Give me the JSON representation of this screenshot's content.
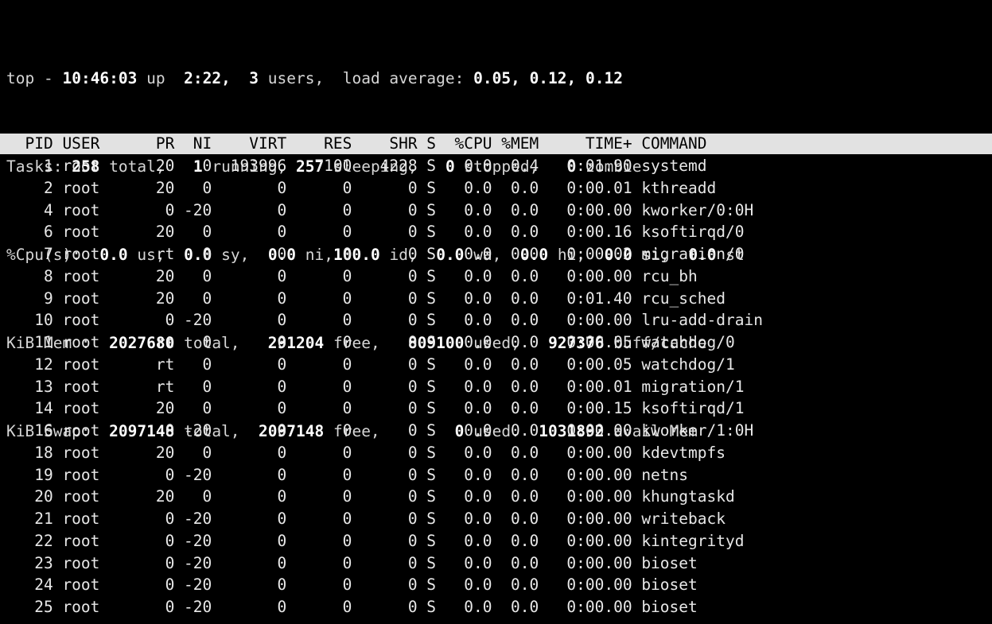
{
  "terminal": {
    "background": "#000000",
    "foreground": "#d8d8d8",
    "bold_foreground": "#ffffff",
    "header_bar_background": "#e2e2e2",
    "header_bar_foreground": "#000000",
    "columns": 86,
    "rows": 28
  },
  "summary": {
    "uptime_line": {
      "program": "top",
      "separator": "-",
      "time": "10:46:03",
      "up_label": "up",
      "uptime": "2:22,",
      "users_count": "3",
      "users_label": "users,",
      "load_label": "load average:",
      "load_1min": "0.05,",
      "load_5min": "0.12,",
      "load_15min": "0.12",
      "text": "top - 10:46:03 up  2:22,  3 users,  load average: 0.05, 0.12, 0.12"
    },
    "tasks_line": {
      "label": "Tasks:",
      "total": "258",
      "total_label": "total,",
      "running": "1",
      "running_label": "running,",
      "sleeping": "257",
      "sleeping_label": "sleeping,",
      "stopped": "0",
      "stopped_label": "stopped,",
      "zombie": "0",
      "zombie_label": "zombie",
      "text": "Tasks: 258 total,   1 running, 257 sleeping,   0 stopped,   0 zombie"
    },
    "cpu_line": {
      "label": "%Cpu(s):",
      "us": "0.0",
      "us_label": "us,",
      "sy": "0.0",
      "sy_label": "sy,",
      "ni": "0.0",
      "ni_label": "ni,",
      "id": "100.0",
      "id_label": "id,",
      "wa": "0.0",
      "wa_label": "wa,",
      "hi": "0.0",
      "hi_label": "hi,",
      "si": "0.0",
      "si_label": "si,",
      "st": "0.0",
      "st_label": "st",
      "text": "%Cpu(s):  0.0 us,  0.0 sy,  0.0 ni,100.0 id,  0.0 wa,  0.0 hi,  0.0 si,  0.0 st"
    },
    "mem_line": {
      "label": "KiB Mem :",
      "total": "2027680",
      "total_label": "total,",
      "free": "291204",
      "free_label": "free,",
      "used": "809100",
      "used_label": "used,",
      "buffcache": "927376",
      "buffcache_label": "buff/cache",
      "text": "KiB Mem :  2027680 total,   291204 free,   809100 used,   927376 buff/cache"
    },
    "swap_line": {
      "label": "KiB Swap:",
      "total": "2097148",
      "total_label": "total,",
      "free": "2097148",
      "free_label": "free,",
      "used": "0",
      "used_label": "used.",
      "avail": "1031892",
      "avail_label": "avail Mem",
      "text": "KiB Swap:  2097148 total,  2097148 free,        0 used.  1031892 avail Mem"
    }
  },
  "table": {
    "header_text": "  PID USER      PR  NI    VIRT    RES    SHR S  %CPU %MEM     TIME+ COMMAND ",
    "columns": [
      "PID",
      "USER",
      "PR",
      "NI",
      "VIRT",
      "RES",
      "SHR",
      "S",
      "%CPU",
      "%MEM",
      "TIME+",
      "COMMAND"
    ],
    "rows": [
      {
        "pid": "1",
        "user": "root",
        "pr": "20",
        "ni": "0",
        "virt": "193996",
        "res": "7100",
        "shr": "4228",
        "s": "S",
        "cpu": "0.0",
        "mem": "0.4",
        "time": "0:01.90",
        "command": "systemd",
        "text": "    1 root      20   0  193996   7100   4228 S   0.0  0.4   0:01.90 systemd"
      },
      {
        "pid": "2",
        "user": "root",
        "pr": "20",
        "ni": "0",
        "virt": "0",
        "res": "0",
        "shr": "0",
        "s": "S",
        "cpu": "0.0",
        "mem": "0.0",
        "time": "0:00.01",
        "command": "kthreadd",
        "text": "    2 root      20   0       0      0      0 S   0.0  0.0   0:00.01 kthreadd"
      },
      {
        "pid": "4",
        "user": "root",
        "pr": "0",
        "ni": "-20",
        "virt": "0",
        "res": "0",
        "shr": "0",
        "s": "S",
        "cpu": "0.0",
        "mem": "0.0",
        "time": "0:00.00",
        "command": "kworker/0:0H",
        "text": "    4 root       0 -20       0      0      0 S   0.0  0.0   0:00.00 kworker/0:0H"
      },
      {
        "pid": "6",
        "user": "root",
        "pr": "20",
        "ni": "0",
        "virt": "0",
        "res": "0",
        "shr": "0",
        "s": "S",
        "cpu": "0.0",
        "mem": "0.0",
        "time": "0:00.16",
        "command": "ksoftirqd/0",
        "text": "    6 root      20   0       0      0      0 S   0.0  0.0   0:00.16 ksoftirqd/0"
      },
      {
        "pid": "7",
        "user": "root",
        "pr": "rt",
        "ni": "0",
        "virt": "0",
        "res": "0",
        "shr": "0",
        "s": "S",
        "cpu": "0.0",
        "mem": "0.0",
        "time": "0:00.02",
        "command": "migration/0",
        "text": "    7 root      rt   0       0      0      0 S   0.0  0.0   0:00.02 migration/0"
      },
      {
        "pid": "8",
        "user": "root",
        "pr": "20",
        "ni": "0",
        "virt": "0",
        "res": "0",
        "shr": "0",
        "s": "S",
        "cpu": "0.0",
        "mem": "0.0",
        "time": "0:00.00",
        "command": "rcu_bh",
        "text": "    8 root      20   0       0      0      0 S   0.0  0.0   0:00.00 rcu_bh"
      },
      {
        "pid": "9",
        "user": "root",
        "pr": "20",
        "ni": "0",
        "virt": "0",
        "res": "0",
        "shr": "0",
        "s": "S",
        "cpu": "0.0",
        "mem": "0.0",
        "time": "0:01.40",
        "command": "rcu_sched",
        "text": "    9 root      20   0       0      0      0 S   0.0  0.0   0:01.40 rcu_sched"
      },
      {
        "pid": "10",
        "user": "root",
        "pr": "0",
        "ni": "-20",
        "virt": "0",
        "res": "0",
        "shr": "0",
        "s": "S",
        "cpu": "0.0",
        "mem": "0.0",
        "time": "0:00.00",
        "command": "lru-add-drain",
        "text": "   10 root       0 -20       0      0      0 S   0.0  0.0   0:00.00 lru-add-drain"
      },
      {
        "pid": "11",
        "user": "root",
        "pr": "rt",
        "ni": "0",
        "virt": "0",
        "res": "0",
        "shr": "0",
        "s": "S",
        "cpu": "0.0",
        "mem": "0.0",
        "time": "0:00.05",
        "command": "watchdog/0",
        "text": "   11 root      rt   0       0      0      0 S   0.0  0.0   0:00.05 watchdog/0"
      },
      {
        "pid": "12",
        "user": "root",
        "pr": "rt",
        "ni": "0",
        "virt": "0",
        "res": "0",
        "shr": "0",
        "s": "S",
        "cpu": "0.0",
        "mem": "0.0",
        "time": "0:00.05",
        "command": "watchdog/1",
        "text": "   12 root      rt   0       0      0      0 S   0.0  0.0   0:00.05 watchdog/1"
      },
      {
        "pid": "13",
        "user": "root",
        "pr": "rt",
        "ni": "0",
        "virt": "0",
        "res": "0",
        "shr": "0",
        "s": "S",
        "cpu": "0.0",
        "mem": "0.0",
        "time": "0:00.01",
        "command": "migration/1",
        "text": "   13 root      rt   0       0      0      0 S   0.0  0.0   0:00.01 migration/1"
      },
      {
        "pid": "14",
        "user": "root",
        "pr": "20",
        "ni": "0",
        "virt": "0",
        "res": "0",
        "shr": "0",
        "s": "S",
        "cpu": "0.0",
        "mem": "0.0",
        "time": "0:00.15",
        "command": "ksoftirqd/1",
        "text": "   14 root      20   0       0      0      0 S   0.0  0.0   0:00.15 ksoftirqd/1"
      },
      {
        "pid": "16",
        "user": "root",
        "pr": "0",
        "ni": "-20",
        "virt": "0",
        "res": "0",
        "shr": "0",
        "s": "S",
        "cpu": "0.0",
        "mem": "0.0",
        "time": "0:00.00",
        "command": "kworker/1:0H",
        "text": "   16 root       0 -20       0      0      0 S   0.0  0.0   0:00.00 kworker/1:0H"
      },
      {
        "pid": "18",
        "user": "root",
        "pr": "20",
        "ni": "0",
        "virt": "0",
        "res": "0",
        "shr": "0",
        "s": "S",
        "cpu": "0.0",
        "mem": "0.0",
        "time": "0:00.00",
        "command": "kdevtmpfs",
        "text": "   18 root      20   0       0      0      0 S   0.0  0.0   0:00.00 kdevtmpfs"
      },
      {
        "pid": "19",
        "user": "root",
        "pr": "0",
        "ni": "-20",
        "virt": "0",
        "res": "0",
        "shr": "0",
        "s": "S",
        "cpu": "0.0",
        "mem": "0.0",
        "time": "0:00.00",
        "command": "netns",
        "text": "   19 root       0 -20       0      0      0 S   0.0  0.0   0:00.00 netns"
      },
      {
        "pid": "20",
        "user": "root",
        "pr": "20",
        "ni": "0",
        "virt": "0",
        "res": "0",
        "shr": "0",
        "s": "S",
        "cpu": "0.0",
        "mem": "0.0",
        "time": "0:00.00",
        "command": "khungtaskd",
        "text": "   20 root      20   0       0      0      0 S   0.0  0.0   0:00.00 khungtaskd"
      },
      {
        "pid": "21",
        "user": "root",
        "pr": "0",
        "ni": "-20",
        "virt": "0",
        "res": "0",
        "shr": "0",
        "s": "S",
        "cpu": "0.0",
        "mem": "0.0",
        "time": "0:00.00",
        "command": "writeback",
        "text": "   21 root       0 -20       0      0      0 S   0.0  0.0   0:00.00 writeback"
      },
      {
        "pid": "22",
        "user": "root",
        "pr": "0",
        "ni": "-20",
        "virt": "0",
        "res": "0",
        "shr": "0",
        "s": "S",
        "cpu": "0.0",
        "mem": "0.0",
        "time": "0:00.00",
        "command": "kintegrityd",
        "text": "   22 root       0 -20       0      0      0 S   0.0  0.0   0:00.00 kintegrityd"
      },
      {
        "pid": "23",
        "user": "root",
        "pr": "0",
        "ni": "-20",
        "virt": "0",
        "res": "0",
        "shr": "0",
        "s": "S",
        "cpu": "0.0",
        "mem": "0.0",
        "time": "0:00.00",
        "command": "bioset",
        "text": "   23 root       0 -20       0      0      0 S   0.0  0.0   0:00.00 bioset"
      },
      {
        "pid": "24",
        "user": "root",
        "pr": "0",
        "ni": "-20",
        "virt": "0",
        "res": "0",
        "shr": "0",
        "s": "S",
        "cpu": "0.0",
        "mem": "0.0",
        "time": "0:00.00",
        "command": "bioset",
        "text": "   24 root       0 -20       0      0      0 S   0.0  0.0   0:00.00 bioset"
      },
      {
        "pid": "25",
        "user": "root",
        "pr": "0",
        "ni": "-20",
        "virt": "0",
        "res": "0",
        "shr": "0",
        "s": "S",
        "cpu": "0.0",
        "mem": "0.0",
        "time": "0:00.00",
        "command": "bioset",
        "text": "   25 root       0 -20       0      0      0 S   0.0  0.0   0:00.00 bioset"
      }
    ]
  }
}
